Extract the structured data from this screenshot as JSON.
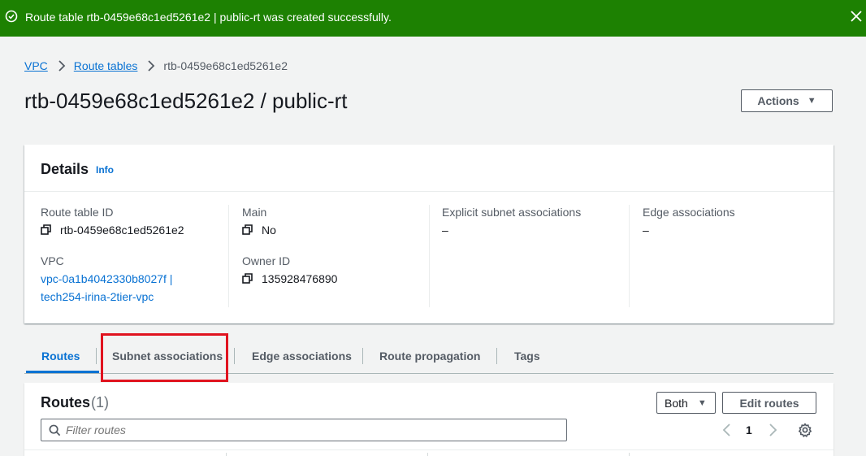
{
  "flash": {
    "message": "Route table rtb-0459e68c1ed5261e2 | public-rt was created successfully.",
    "status": "success",
    "color": "#1d8102",
    "icon": "check-circle-icon",
    "close_icon": "close-icon"
  },
  "breadcrumb": {
    "items": [
      "VPC",
      "Route tables",
      "rtb-0459e68c1ed5261e2"
    ]
  },
  "page": {
    "title": "rtb-0459e68c1ed5261e2 / public-rt",
    "actions_label": "Actions"
  },
  "details": {
    "title": "Details",
    "info_label": "Info",
    "fields": {
      "route_table_id_label": "Route table ID",
      "route_table_id_value": "rtb-0459e68c1ed5261e2",
      "vpc_label": "VPC",
      "vpc_value_line1": "vpc-0a1b4042330b8027f |",
      "vpc_value_line2": "tech254-irina-2tier-vpc",
      "main_label": "Main",
      "main_value": "No",
      "owner_id_label": "Owner ID",
      "owner_id_value": "135928476890",
      "explicit_label": "Explicit subnet associations",
      "explicit_value": "–",
      "edge_label": "Edge associations",
      "edge_value": "–"
    }
  },
  "tabs": {
    "items": [
      "Routes",
      "Subnet associations",
      "Edge associations",
      "Route propagation",
      "Tags"
    ],
    "active": "Routes",
    "highlight_color": "#e0131f"
  },
  "routes": {
    "title": "Routes",
    "count": "(1)",
    "filter_select": "Both",
    "edit_label": "Edit routes",
    "filter_placeholder": "Filter routes",
    "page": "1"
  }
}
